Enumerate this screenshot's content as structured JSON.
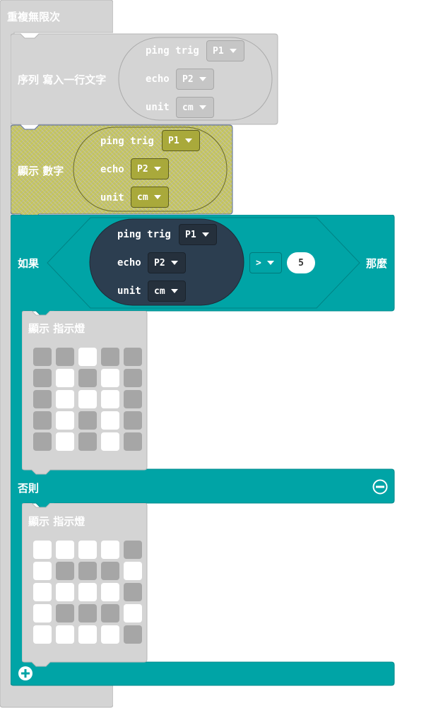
{
  "loop": {
    "label": "重複無限次"
  },
  "serial_block": {
    "label": "序列 寫入一行文字",
    "ping_label": "ping trig",
    "ping_value": "P1",
    "echo_label": "echo",
    "echo_value": "P2",
    "unit_label": "unit",
    "unit_value": "cm"
  },
  "show_number_block": {
    "label": "顯示 數字",
    "ping_label": "ping trig",
    "ping_value": "P1",
    "echo_label": "echo",
    "echo_value": "P2",
    "unit_label": "unit",
    "unit_value": "cm"
  },
  "if_block": {
    "if_label": "如果",
    "then_label": "那麼",
    "ping_label": "ping trig",
    "ping_value": "P1",
    "echo_label": "echo",
    "echo_value": "P2",
    "unit_label": "unit",
    "unit_value": "cm",
    "operator": ">",
    "compare_value": "5",
    "else_label": "否則"
  },
  "leds_then": {
    "label": "顯示 指示燈",
    "grid": [
      [
        0,
        0,
        1,
        0,
        0
      ],
      [
        0,
        1,
        0,
        1,
        0
      ],
      [
        0,
        1,
        1,
        1,
        0
      ],
      [
        0,
        1,
        0,
        1,
        0
      ],
      [
        0,
        1,
        0,
        1,
        0
      ]
    ]
  },
  "leds_else": {
    "label": "顯示 指示燈",
    "grid": [
      [
        1,
        1,
        1,
        1,
        0
      ],
      [
        1,
        0,
        0,
        0,
        1
      ],
      [
        1,
        1,
        1,
        1,
        0
      ],
      [
        1,
        0,
        0,
        0,
        1
      ],
      [
        1,
        1,
        1,
        1,
        0
      ]
    ]
  },
  "colors": {
    "loop_grey": "#d4d4d4",
    "olive": "#c5c55a",
    "teal": "#00a4a6",
    "dark_oval": "#2c3e50"
  }
}
